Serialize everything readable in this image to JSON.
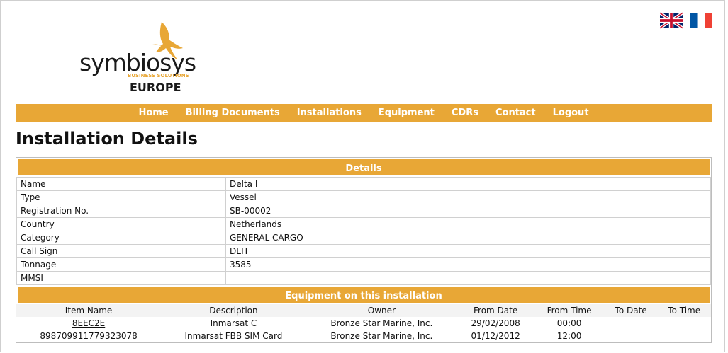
{
  "logo": {
    "brand": "symbiosys",
    "tagline": "BUSINESS SOLUTIONS",
    "region": "EUROPE"
  },
  "languages": [
    {
      "code": "en",
      "icon": "uk-flag-icon"
    },
    {
      "code": "fr",
      "icon": "france-flag-icon"
    }
  ],
  "nav": {
    "items": [
      "Home",
      "Billing Documents",
      "Installations",
      "Equipment",
      "CDRs",
      "Contact",
      "Logout"
    ]
  },
  "page_title": "Installation Details",
  "details": {
    "header": "Details",
    "rows": [
      {
        "label": "Name",
        "value": "Delta I"
      },
      {
        "label": "Type",
        "value": "Vessel"
      },
      {
        "label": "Registration No.",
        "value": "SB-00002"
      },
      {
        "label": "Country",
        "value": "Netherlands"
      },
      {
        "label": "Category",
        "value": "GENERAL CARGO"
      },
      {
        "label": "Call Sign",
        "value": "DLTI"
      },
      {
        "label": "Tonnage",
        "value": "3585"
      },
      {
        "label": "MMSI",
        "value": ""
      }
    ]
  },
  "equipment": {
    "header": "Equipment on this installation",
    "columns": [
      "Item Name",
      "Description",
      "Owner",
      "From Date",
      "From Time",
      "To Date",
      "To Time"
    ],
    "rows": [
      [
        "8EEC2E",
        "Inmarsat C",
        "Bronze Star Marine, Inc.",
        "29/02/2008",
        "00:00",
        "",
        ""
      ],
      [
        "898709911779323078",
        "Inmarsat FBB SIM Card",
        "Bronze Star Marine, Inc.",
        "01/12/2012",
        "12:00",
        "",
        ""
      ]
    ]
  },
  "colors": {
    "accent": "#e8a736",
    "logo_dark": "#1a1a1a"
  }
}
